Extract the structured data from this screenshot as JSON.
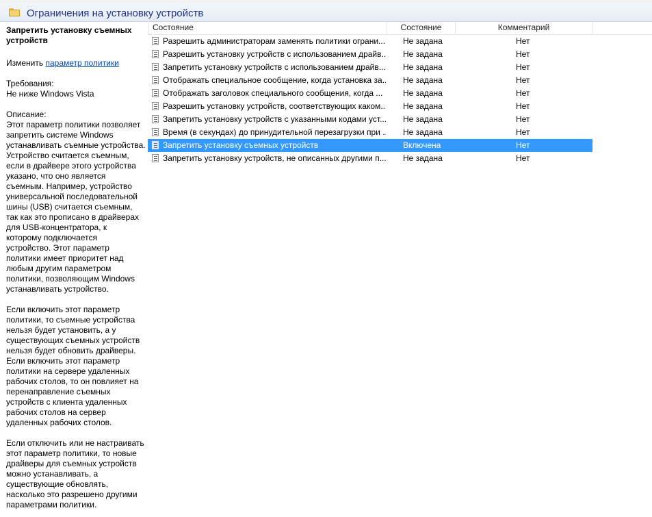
{
  "header": {
    "title": "Ограничения на установку устройств"
  },
  "left_panel": {
    "policy_title": "Запретить установку съемных устройств",
    "edit_prefix": "Изменить ",
    "edit_link": "параметр политики",
    "requirements_label": "Требования:",
    "requirements_value": "Не ниже Windows Vista",
    "description_label": "Описание:",
    "description_lines": [
      "Этот параметр политики позволяет",
      "запретить системе Windows",
      "устанавливать съемные устройства.",
      "Устройство считается съемным,",
      "если в драйвере этого устройства",
      "указано, что оно является",
      "съемным. Например, устройство",
      "универсальной последовательной",
      "шины (USB) считается съемным,",
      "так как это прописано в драйверах",
      "для USB-концентратора, к",
      "которому подключается",
      "устройство. Этот параметр",
      "политики имеет приоритет над",
      "любым другим параметром",
      "политики, позволяющим Windows",
      "устанавливать устройство."
    ],
    "para2_lines": [
      "Если включить этот параметр",
      "политики, то съемные устройства",
      "нельзя будет установить, а у",
      "существующих съемных устройств",
      "нельзя будет обновить драйверы.",
      "Если включить этот параметр",
      "политики на сервере удаленных",
      "рабочих столов, то он повлияет на",
      "перенаправление съемных",
      "устройств с клиента удаленных",
      "рабочих столов на сервер",
      "удаленных рабочих столов."
    ],
    "para3_lines": [
      "Если отключить или не настраивать",
      "этот параметр политики, то новые",
      "драйверы для съемных устройств",
      "можно устанавливать, а",
      "существующие обновлять,",
      "насколько это разрешено другими",
      "параметрами политики."
    ]
  },
  "table": {
    "columns": [
      "Состояние",
      "Состояние",
      "Комментарий"
    ],
    "rows": [
      {
        "name": "Разрешить администраторам заменять политики ограни...",
        "state": "Не задана",
        "comment": "Нет"
      },
      {
        "name": "Разрешить установку устройств с использованием драйв...",
        "state": "Не задана",
        "comment": "Нет"
      },
      {
        "name": "Запретить установку устройств с использованием драйв...",
        "state": "Не задана",
        "comment": "Нет"
      },
      {
        "name": "Отображать специальное сообщение, когда установка за...",
        "state": "Не задана",
        "comment": "Нет"
      },
      {
        "name": "Отображать заголовок специального сообщения, когда ...",
        "state": "Не задана",
        "comment": "Нет"
      },
      {
        "name": "Разрешить установку устройств, соответствующих каком...",
        "state": "Не задана",
        "comment": "Нет"
      },
      {
        "name": "Запретить установку устройств с указанными кодами уст...",
        "state": "Не задана",
        "comment": "Нет"
      },
      {
        "name": "Время (в секундах) до принудительной перезагрузки при ...",
        "state": "Не задана",
        "comment": "Нет"
      },
      {
        "name": "Запретить установку съемных устройств",
        "state": "Включена",
        "comment": "Нет"
      },
      {
        "name": "Запретить установку устройств, не описанных другими п...",
        "state": "Не задана",
        "comment": "Нет"
      }
    ],
    "selected_index": 8,
    "selection_color": "#3399ff"
  },
  "icons": {
    "header": "folder-icon",
    "row": "policy-setting-icon"
  }
}
